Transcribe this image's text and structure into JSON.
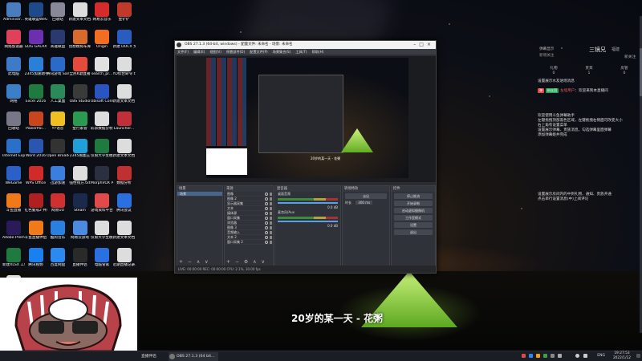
{
  "desktop": {
    "icons": [
      {
        "label": "Administr...",
        "color": "#4a7cc0"
      },
      {
        "label": "英雄联盟WeGame版",
        "color": "#1f4a8a"
      },
      {
        "label": "回收站",
        "color": "#889"
      },
      {
        "label": "新建文本文档.txt",
        "color": "#ddd"
      },
      {
        "label": "网易云音乐",
        "color": "#d62b2b"
      },
      {
        "label": "金铲铲",
        "color": "#c0392b"
      },
      {
        "label": "网络加速器",
        "color": "#e0405a"
      },
      {
        "label": "GOG GALAXY",
        "color": "#6b2fb0"
      },
      {
        "label": "英雄联盟",
        "color": "#2a3a70"
      },
      {
        "label": "创想模拟车库",
        "color": "#d96a2a"
      },
      {
        "label": "Origin",
        "color": "#f06d22"
      },
      {
        "label": "新建 DOCX 文档.docx",
        "color": "#2a5cc0"
      },
      {
        "label": "此电脑",
        "color": "#3d7ac8"
      },
      {
        "label": "2345加速助手",
        "color": "#2a80d6"
      },
      {
        "label": "腾讯游戏 SamPro",
        "color": "#2a6ac8"
      },
      {
        "label": "全民K歌直播",
        "color": "#e64a3a"
      },
      {
        "label": "search_pr...",
        "color": "#e0e0e0"
      },
      {
        "label": "YD综合命令.txt",
        "color": "#ddd"
      },
      {
        "label": "网络",
        "color": "#3a7fc8"
      },
      {
        "label": "Excel 2016",
        "color": "#1e7a3e"
      },
      {
        "label": "人工桌面",
        "color": "#2a8a5a"
      },
      {
        "label": "OBS Studio",
        "color": "#3a3a3a"
      },
      {
        "label": "Ubisoft Connect",
        "color": "#2a55c0"
      },
      {
        "label": "新建文本文档 (4).txt",
        "color": "#ddd"
      },
      {
        "label": "回收站",
        "color": "#778"
      },
      {
        "label": "PowerPoi...",
        "color": "#c8461e"
      },
      {
        "label": "YY语音",
        "color": "#f0c020"
      },
      {
        "label": "金行家管",
        "color": "#2a9a50"
      },
      {
        "label": "彩票数据分析统计.txt",
        "color": "#ddd"
      },
      {
        "label": "Launcher...",
        "color": "#c0303a"
      },
      {
        "label": "Internet Explorer",
        "color": "#2a70c8"
      },
      {
        "label": "Word 2016",
        "color": "#2a56b0"
      },
      {
        "label": "Open Broadcast",
        "color": "#333"
      },
      {
        "label": "2345看图王",
        "color": "#20a0d8"
      },
      {
        "label": "仅限大学生模板.xlsx",
        "color": "#1e7a3e"
      },
      {
        "label": "新建文本文档 (2).txt",
        "color": "#ddd"
      },
      {
        "label": "WeGame",
        "color": "#2a60c8"
      },
      {
        "label": "WPS Office",
        "color": "#d02a2a"
      },
      {
        "label": "迅游加速",
        "color": "#3a7fe0"
      },
      {
        "label": "强性钱方.txt",
        "color": "#ddd"
      },
      {
        "label": "MorphVOX Pro",
        "color": "#2a3040"
      },
      {
        "label": "数据分析",
        "color": "#c03030"
      },
      {
        "label": "斗鱼直播",
        "color": "#f07a1a"
      },
      {
        "label": "红色警戒2 共和国之辉",
        "color": "#b02020"
      },
      {
        "label": "网易UU",
        "color": "#d03030"
      },
      {
        "label": "Steam",
        "color": "#1a2a4a"
      },
      {
        "label": "游戏资料平台",
        "color": "#e04a4a"
      },
      {
        "label": "腾讯会议",
        "color": "#2a70e0"
      },
      {
        "label": "Adobe Premie...",
        "color": "#2a1a5a"
      },
      {
        "label": "斗鱼直播伴侣",
        "color": "#f07a1a"
      },
      {
        "label": "酷狗音乐",
        "color": "#2a80e0"
      },
      {
        "label": "网易云游戏",
        "color": "#4a8ae0"
      },
      {
        "label": "仅限大学生模板.txt",
        "color": "#ddd"
      },
      {
        "label": "新建文本文档 (2).txt",
        "color": "#ddd"
      },
      {
        "label": "新建XLSX 工作表.xlsx",
        "color": "#1e7a3e"
      },
      {
        "label": "腾讯视频",
        "color": "#1a80f0"
      },
      {
        "label": "百度网盘",
        "color": "#2a8af0"
      },
      {
        "label": "直播伴侣",
        "color": "#2a2a2a"
      },
      {
        "label": "电脑管家",
        "color": "#2a70e0"
      },
      {
        "label": "近期直播记录.txt",
        "color": "#ddd"
      },
      {
        "label": "新建文本文档.txt",
        "color": "#ddd"
      }
    ]
  },
  "obs": {
    "title": "OBS 27.1.3 (64-bit, windows) - 配置文件: 未命名 - 场景: 未命名",
    "menu": [
      "文件(F)",
      "编辑(E)",
      "视图(V)",
      "停靠部件(D)",
      "配置文件(P)",
      "场景集合(S)",
      "工具(T)",
      "帮助(H)"
    ],
    "preview_caption": "20岁的某一天 - 花粥",
    "docks": {
      "scenes_title": "场景",
      "scenes": [
        "场景"
      ],
      "sources_title": "来源",
      "sources": [
        "图像",
        "图像 2",
        "显示器采集",
        "文本",
        "媒体源",
        "窗口采集",
        "浏览器",
        "图像 3",
        "音频输入",
        "文本 2",
        "窗口采集 2"
      ],
      "mixer_title": "混音器",
      "mixer_tracks": [
        {
          "name": "桌面音频",
          "db": "0.0 dB"
        },
        {
          "name": "麦克风/Aux",
          "db": "0.0 dB"
        }
      ],
      "transitions_title": "转场特效",
      "transition_type": "淡出",
      "duration_label": "时长",
      "duration_value": "300 ms",
      "controls_title": "控件",
      "controls": [
        "停止推流",
        "开始录制",
        "启动虚拟摄像机",
        "工作室模式",
        "设置",
        "退出"
      ]
    },
    "status": "LIVE: 00:00:00   REC: 00:00:00   CPU: 2.1%, 30.00 fps"
  },
  "subtitle": "20岁的某一天 - 花粥",
  "right_panel": {
    "header_left": "弹幕显示",
    "header_sub": "新增关注",
    "name": "三镜兄",
    "location": "福建",
    "sub": "新关注",
    "tabs": [
      {
        "label": "礼物",
        "count": "0"
      },
      {
        "label": "贵宾",
        "count": "1"
      },
      {
        "label": "房管",
        "count": "0"
      }
    ],
    "line1": "设置展示水友进场消息",
    "line2_badge_red": "弹",
    "line2_badge_green": "粉丝团",
    "line2_user": "左墙用户",
    "line2_text": "欢迎来到本直播间",
    "block1": [
      "欢迎使用斗鱼弹幕助手",
      "左键拖拽顶部黑色区域，左键拖拽右侧面可改变大小",
      "右上角有设置菜单",
      "设置展示弹幕、贵族消息，勾选弹幕里面弹幕",
      "添加弹幕姬并完成"
    ],
    "block2": [
      "设置展示房间内的中到礼物、通知、贵族开通",
      "点击单行设置消息(中)上阅评论"
    ]
  },
  "taskbar": {
    "tasks": [
      {
        "label": "直播伴侣"
      },
      {
        "label": "OBS 27.1.3 (64 bit..."
      }
    ],
    "lang": "ENG",
    "time": "19:27:53",
    "date": "2022/1/12"
  }
}
